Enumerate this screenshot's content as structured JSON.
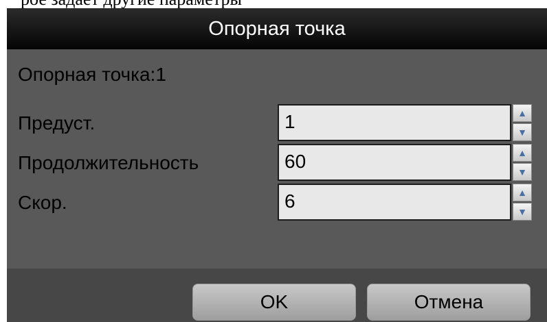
{
  "top_text": "рое задаёт другие параметры",
  "dialog": {
    "title": "Опорная точка",
    "ref_label": "Опорная точка:1",
    "fields": [
      {
        "label": "Предуст.",
        "value": "1"
      },
      {
        "label": "Продолжительность",
        "value": "60"
      },
      {
        "label": "Скор.",
        "value": "6"
      }
    ],
    "buttons": {
      "ok": "OK",
      "cancel": "Отмена"
    },
    "spinner_icons": {
      "up": "▲",
      "down": "▼"
    }
  }
}
